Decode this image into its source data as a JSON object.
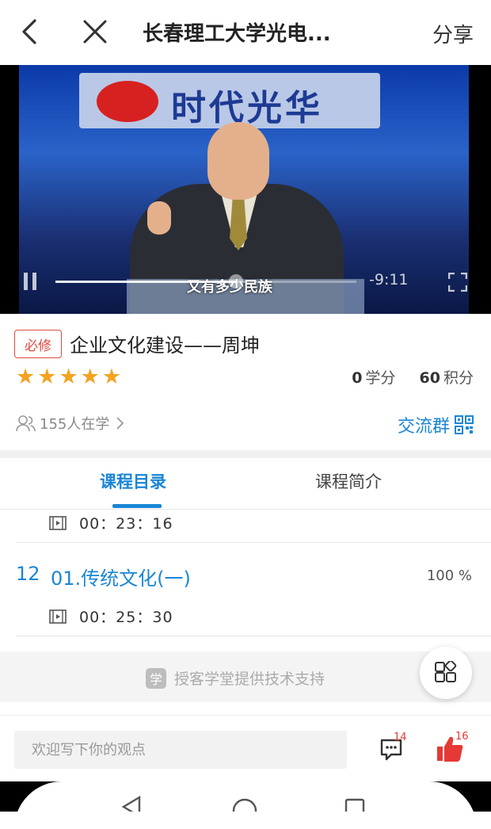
{
  "nav": {
    "title": "长春理工大学光电...",
    "share_label": "分享"
  },
  "video": {
    "banner_text": "时代光华",
    "subtitle": "又有多少民族",
    "remaining_time": "-9:11",
    "progress": 0.6
  },
  "course": {
    "required_badge": "必修",
    "title": "企业文化建设——周坤",
    "rating_stars": 5,
    "credit_value": "0",
    "credit_unit": "学分",
    "points_value": "60",
    "points_unit": "积分",
    "learners_text": "155人在学",
    "group_label": "交流群"
  },
  "tabs": [
    {
      "label": "课程目录",
      "active": true
    },
    {
      "label": "课程简介",
      "active": false
    }
  ],
  "lessons": {
    "prev_duration": "00：23：16",
    "current": {
      "number": "12",
      "title": "01.传统文化(一)",
      "progress": "100 %",
      "duration": "00：25：30"
    }
  },
  "support": {
    "logo_text": "学",
    "text": "授客学堂提供技术支持"
  },
  "bottom": {
    "comment_placeholder": "欢迎写下你的观点",
    "comment_count": "14",
    "like_count": "16"
  },
  "colors": {
    "accent": "#1a86d6",
    "star": "#f3a322",
    "required": "#e04a3f",
    "like": "#e53935"
  }
}
